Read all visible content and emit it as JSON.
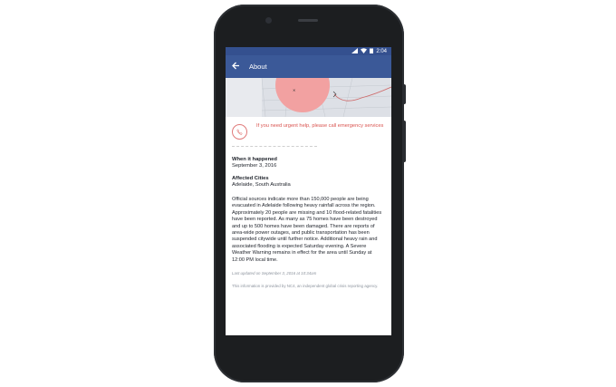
{
  "status_bar": {
    "time": "2:04"
  },
  "app_bar": {
    "title": "About"
  },
  "alert": {
    "text": "If you need urgent help, please call emergency services"
  },
  "event": {
    "when_label": "When it happened",
    "when_value": "September 3, 2016",
    "cities_label": "Affected Cities",
    "cities_value": "Adelaide, South Australia"
  },
  "description": "Official sources indicate more than 150,000 people are being evacuated in Adelaide following heavy rainfall across the region. Approximately 20 people are missing and 10 flood-related fatalities have been reported. As many as 75 homes have been destroyed and up to 500 homes have been damaged. There are reports of area-wide power outages, and public transportation has been suspended citywide until further notice. Additional heavy rain and associated flooding is expected Saturday evening. A Severe Weather Warning remains in effect for the area until Sunday at 12:00 PM local time.",
  "footer": {
    "updated": "Last updated on September 3, 2016 at 10:34am",
    "source": "This information is provided by NC4, an independent global crisis reporting agency."
  },
  "colors": {
    "app_bar": "#3b5998",
    "alert": "#d9534f",
    "map_zone": "#f2a1a1"
  },
  "icons": {
    "back": "arrow-left-icon",
    "phone": "phone-icon",
    "wifi": "wifi-icon",
    "signal": "signal-icon",
    "battery": "battery-icon"
  }
}
